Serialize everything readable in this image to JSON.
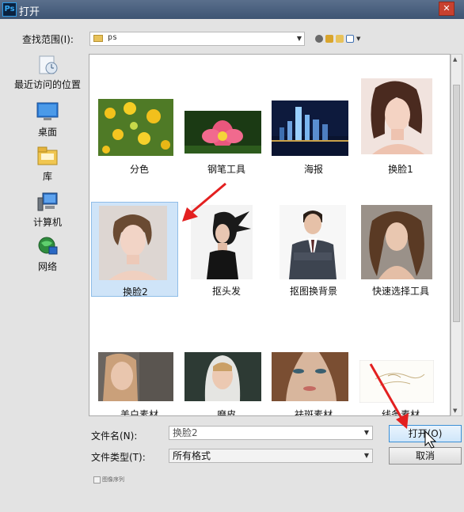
{
  "window": {
    "app_icon": "Ps",
    "title": "打开",
    "close": "✕"
  },
  "lookin": {
    "label": "查找范围(I):",
    "value": "ps"
  },
  "places": [
    {
      "label": "最近访问的位置",
      "icon": "recent-icon"
    },
    {
      "label": "桌面",
      "icon": "desktop-icon"
    },
    {
      "label": "库",
      "icon": "library-icon"
    },
    {
      "label": "计算机",
      "icon": "computer-icon"
    },
    {
      "label": "网络",
      "icon": "network-icon"
    }
  ],
  "files": [
    {
      "name": "分色",
      "thumb": "yellow-flowers"
    },
    {
      "name": "钢笔工具",
      "thumb": "lotus-flower"
    },
    {
      "name": "海报",
      "thumb": "city-skyline"
    },
    {
      "name": "换脸1",
      "thumb": "portrait-woman-1"
    },
    {
      "name": "换脸2",
      "thumb": "portrait-woman-2",
      "selected": true
    },
    {
      "name": "抠头发",
      "thumb": "woman-hair"
    },
    {
      "name": "抠图换背景",
      "thumb": "man-in-suit"
    },
    {
      "name": "快速选择工具",
      "thumb": "portrait-woman-curly"
    },
    {
      "name": "美白素材",
      "thumb": "woman-face"
    },
    {
      "name": "磨皮",
      "thumb": "woman-hood"
    },
    {
      "name": "祛斑素材",
      "thumb": "woman-closeup"
    },
    {
      "name": "线条素材",
      "thumb": "line-sketch"
    }
  ],
  "filename": {
    "label": "文件名(N):",
    "value": "换脸2"
  },
  "filetype": {
    "label": "文件类型(T):",
    "value": "所有格式"
  },
  "buttons": {
    "open": "打开(O)",
    "cancel": "取消"
  },
  "sequence": {
    "label": "图像序列",
    "checked": false
  }
}
